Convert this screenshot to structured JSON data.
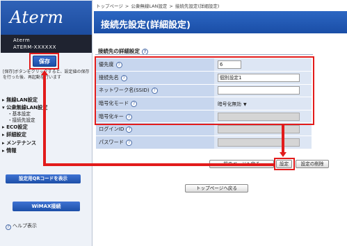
{
  "brand": {
    "logo_text": "Aterm"
  },
  "device": {
    "name": "Aterm",
    "model": "ATERM-XXXXXX"
  },
  "sidebar": {
    "save_label": "保存",
    "notice": "[保存]ボタンをクリックすると、設定値の保存を行った後、再起動を行います",
    "nav": [
      {
        "label": "無線LAN設定",
        "type": "section"
      },
      {
        "label": "公衆無線LAN設定",
        "type": "section"
      },
      {
        "label": "基本設定",
        "type": "sub"
      },
      {
        "label": "接続先設定",
        "type": "sub"
      },
      {
        "label": "ECO設定",
        "type": "section"
      },
      {
        "label": "詳細設定",
        "type": "section"
      },
      {
        "label": "メンテナンス",
        "type": "section"
      },
      {
        "label": "情報",
        "type": "section"
      }
    ],
    "qr_label": "設定用QRコードを表示",
    "wimax_label": "WiMAX接続",
    "help_label": "ヘルプ表示"
  },
  "breadcrumb": [
    "トップページ",
    "公衆無線LAN設定",
    "接続先設定(詳細設定)"
  ],
  "page_title": "接続先設定(詳細設定)",
  "section_title": "接続先の詳細設定",
  "form": {
    "priority": {
      "label": "優先度",
      "value": "6"
    },
    "name": {
      "label": "接続先名",
      "value": "個別設定1"
    },
    "ssid": {
      "label": "ネットワーク名(SSID)",
      "value": ""
    },
    "encryption_mode": {
      "label": "暗号化モード",
      "value": "暗号化無効"
    },
    "encryption_key": {
      "label": "暗号化キー",
      "value": ""
    },
    "login_id": {
      "label": "ログインID",
      "value": ""
    },
    "password": {
      "label": "パスワード",
      "value": ""
    }
  },
  "buttons": {
    "back": "前のページへ戻る",
    "set": "設定",
    "delete": "設定の削除",
    "top": "トップページへ戻る"
  },
  "annotation_color": "#e21b1b",
  "accent_color": "#1a4ea7"
}
